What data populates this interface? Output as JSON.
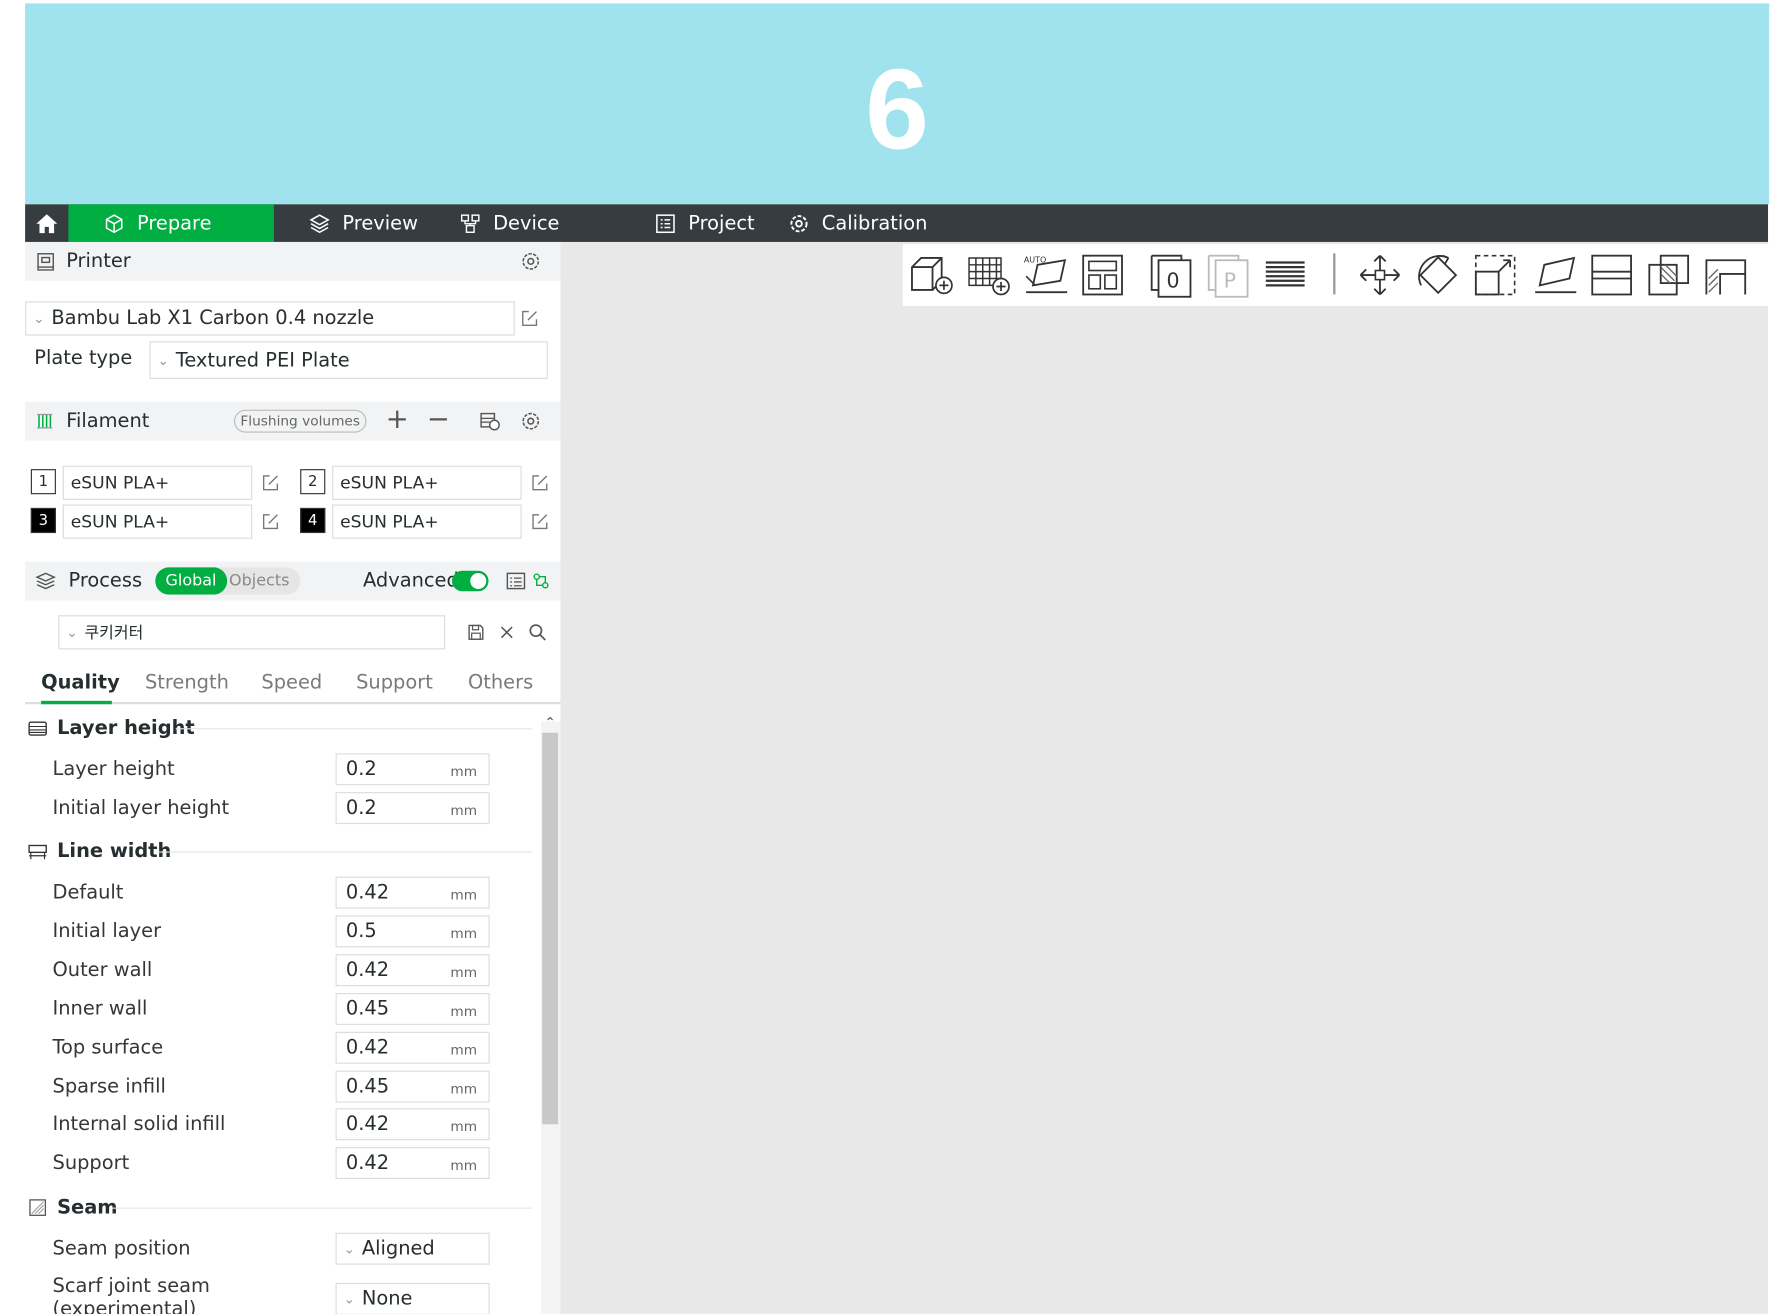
{
  "banner": {
    "number": "6",
    "color": "#a0e3ef"
  },
  "topbar": {
    "tabs": [
      {
        "label": "Prepare",
        "icon": "cube-icon",
        "active": true
      },
      {
        "label": "Preview",
        "icon": "layers-icon"
      },
      {
        "label": "Device",
        "icon": "device-icon"
      },
      {
        "label": "Project",
        "icon": "project-icon"
      },
      {
        "label": "Calibration",
        "icon": "calibration-icon"
      }
    ],
    "accent": "#00ae42",
    "background": "#363d40"
  },
  "printer": {
    "section_title": "Printer",
    "selected_printer": "Bambu Lab X1 Carbon 0.4 nozzle",
    "plate_type_label": "Plate type",
    "plate_type_value": "Textured PEI Plate"
  },
  "filament": {
    "section_title": "Filament",
    "flushing_label": "Flushing volumes",
    "slots": [
      {
        "num": "1",
        "name": "eSUN PLA+",
        "dark": false
      },
      {
        "num": "2",
        "name": "eSUN PLA+",
        "dark": false
      },
      {
        "num": "3",
        "name": "eSUN PLA+",
        "dark": true
      },
      {
        "num": "4",
        "name": "eSUN PLA+",
        "dark": true
      }
    ]
  },
  "process": {
    "section_title": "Process",
    "global_label": "Global",
    "objects_label": "Objects",
    "advanced_label": "Advanced",
    "advanced_on": true,
    "preset": "쿠키커터",
    "tabs": [
      "Quality",
      "Strength",
      "Speed",
      "Support",
      "Others"
    ],
    "active_tab": "Quality"
  },
  "settings": {
    "layer_height_group": "Layer height",
    "layer_height": {
      "label": "Layer height",
      "value": "0.2",
      "unit": "mm"
    },
    "initial_layer_height": {
      "label": "Initial layer height",
      "value": "0.2",
      "unit": "mm"
    },
    "line_width_group": "Line width",
    "line_default": {
      "label": "Default",
      "value": "0.42",
      "unit": "mm"
    },
    "line_initial": {
      "label": "Initial layer",
      "value": "0.5",
      "unit": "mm"
    },
    "line_outer": {
      "label": "Outer wall",
      "value": "0.42",
      "unit": "mm"
    },
    "line_inner": {
      "label": "Inner wall",
      "value": "0.45",
      "unit": "mm"
    },
    "line_top": {
      "label": "Top surface",
      "value": "0.42",
      "unit": "mm"
    },
    "line_sparse": {
      "label": "Sparse infill",
      "value": "0.45",
      "unit": "mm"
    },
    "line_internal": {
      "label": "Internal solid infill",
      "value": "0.42",
      "unit": "mm"
    },
    "line_support": {
      "label": "Support",
      "value": "0.42",
      "unit": "mm"
    },
    "seam_group": "Seam",
    "seam_position": {
      "label": "Seam position",
      "value": "Aligned"
    },
    "scarf_joint": {
      "label_line1": "Scarf joint seam",
      "label_line2": "(experimental)",
      "value": "None"
    }
  },
  "toolbar_icons": [
    "add-object-icon",
    "add-plate-icon",
    "auto-orient-icon",
    "arrange-icon",
    "copy-0-icon",
    "plate-p-icon",
    "layers-stack-icon",
    "move-icon",
    "rotate-icon",
    "scale-icon",
    "lay-on-face-icon",
    "cut-icon",
    "boolean-icon",
    "support-paint-icon"
  ]
}
